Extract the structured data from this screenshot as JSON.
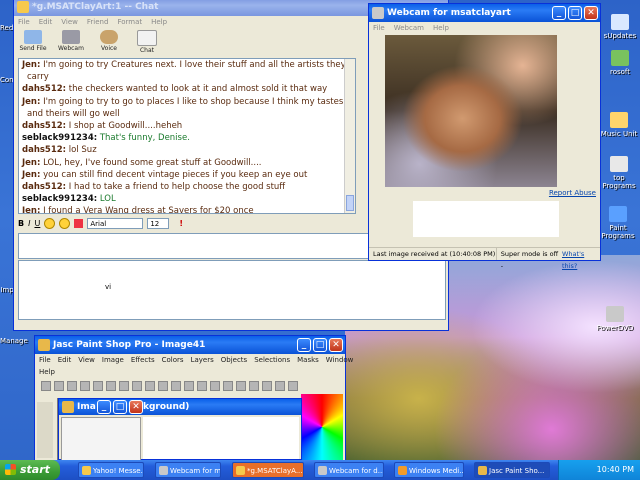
{
  "desktop": {
    "icons": [
      {
        "label": "Red",
        "icon": "app-icon"
      },
      {
        "label": "Com",
        "icon": "app-icon"
      },
      {
        "label": "Imp",
        "icon": "app-icon"
      },
      {
        "label": "Manage",
        "icon": "app-icon"
      },
      {
        "label": "sUpdates",
        "icon": "app-icon"
      },
      {
        "label": "rosoft",
        "icon": "app-icon"
      },
      {
        "label": "Music Unit",
        "icon": "music-icon"
      },
      {
        "label": "top Programs",
        "icon": "app-icon"
      },
      {
        "label": "Paint Programs",
        "icon": "paint-icon"
      },
      {
        "label": "PowerDVD",
        "icon": "dvd-icon"
      }
    ]
  },
  "chat": {
    "title": "*g.MSATClayArt:1 -- Chat",
    "menu": [
      "File",
      "Edit",
      "View",
      "Friend",
      "Format",
      "Help"
    ],
    "tools": [
      "Send File",
      "Webcam",
      "Voice",
      "Chat"
    ],
    "messages": [
      {
        "user": "Jen:",
        "text": "I'm going to try Creatures next. I love their stuff and all the artists they",
        "style": "a"
      },
      {
        "user": "",
        "text": "carry",
        "style": "a"
      },
      {
        "user": "dahs512:",
        "text": "the checkers wanted to look at it and almost sold it that way",
        "style": "a"
      },
      {
        "user": "Jen:",
        "text": "I'm going to try to go to places I like to shop because I think my tastes",
        "style": "a"
      },
      {
        "user": "",
        "text": "and theirs will go well",
        "style": "a"
      },
      {
        "user": "dahs512:",
        "text": "I shop at Goodwill....heheh",
        "style": "a"
      },
      {
        "user": "seblack991234:",
        "text": "That's funny, Denise.",
        "style": "b"
      },
      {
        "user": "dahs512:",
        "text": "lol Suz",
        "style": "a"
      },
      {
        "user": "Jen:",
        "text": "LOL, hey, I've found some great stuff at Goodwill....",
        "style": "a"
      },
      {
        "user": "Jen:",
        "text": "you can still find decent vintage pieces if you keep an eye out",
        "style": "a"
      },
      {
        "user": "dahs512:",
        "text": "I had to take a friend to help choose the good stuff",
        "style": "a"
      },
      {
        "user": "seblack991234:",
        "text": "LOL",
        "style": "b"
      },
      {
        "user": "Jen:",
        "text": "I found a Vera Wang dress at Savers for $20 once",
        "style": "a"
      }
    ],
    "format": {
      "bold": "B",
      "italic": "I",
      "underline": "U",
      "font": "Arial",
      "size": "12"
    },
    "input_text": "vi"
  },
  "webcam": {
    "title": "Webcam for msatclayart",
    "menu": [
      "File",
      "Webcam",
      "Help"
    ],
    "report_abuse": "Report Abuse",
    "status_left": "Last image received at (10:40:08 PM)",
    "status_right": "Super mode is off -",
    "status_link": "What's this?"
  },
  "psp": {
    "title": "Jasc Paint Shop Pro - Image41",
    "menu": [
      "File",
      "Edit",
      "View",
      "Image",
      "Effects",
      "Colors",
      "Layers",
      "Objects",
      "Selections",
      "Masks",
      "Window"
    ],
    "menu2": [
      "Help"
    ],
    "sub_title": "Ima",
    "sub_caption": "kground)"
  },
  "taskbar": {
    "start": "start",
    "tasks": [
      "Yahoo! Messe...",
      "Webcam for m...",
      "*g.MSATClayA...",
      "Webcam for d...",
      "Windows Medi...",
      "Jasc Paint Sho..."
    ],
    "clock": "10:40 PM"
  }
}
